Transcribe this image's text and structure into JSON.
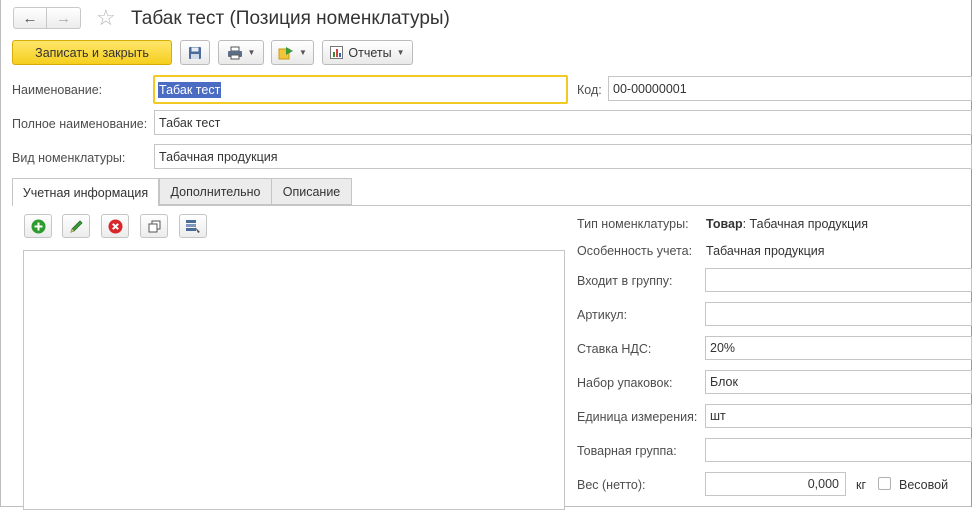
{
  "window": {
    "title": "Табак тест (Позиция номенклатуры)",
    "back_icon": "←",
    "forward_icon": "→",
    "star_icon": "☆"
  },
  "toolbar": {
    "save_close_label": "Записать и закрыть",
    "reports_label": "Отчеты"
  },
  "header_fields": {
    "name_label": "Наименование:",
    "name_value": "Табак тест",
    "code_label": "Код:",
    "code_value": "00-00000001",
    "full_name_label": "Полное наименование:",
    "full_name_value": "Табак тест",
    "kind_label": "Вид номенклатуры:",
    "kind_value": "Табачная продукция"
  },
  "tabs": [
    {
      "label": "Учетная информация"
    },
    {
      "label": "Дополнительно"
    },
    {
      "label": "Описание"
    }
  ],
  "details": {
    "type_label": "Тип номенклатуры:",
    "type_value_bold": "Товар",
    "type_value_rest": ": Табачная продукция",
    "accounting_label": "Особенность учета:",
    "accounting_value": "Табачная продукция",
    "group_label": "Входит в группу:",
    "group_value": "",
    "article_label": "Артикул:",
    "article_value": "",
    "vat_label": "Ставка НДС:",
    "vat_value": "20%",
    "packages_label": "Набор упаковок:",
    "packages_value": "Блок",
    "unit_label": "Единица измерения:",
    "unit_value": "шт",
    "product_group_label": "Товарная группа:",
    "product_group_value": "",
    "weight_label": "Вес (нетто):",
    "weight_value": "0,000",
    "weight_unit": "кг",
    "weighted_label": "Весовой"
  },
  "colors": {
    "primary_button": "#f5cf1e",
    "focus_border": "#f1c923",
    "selection": "#4a6cc2"
  }
}
